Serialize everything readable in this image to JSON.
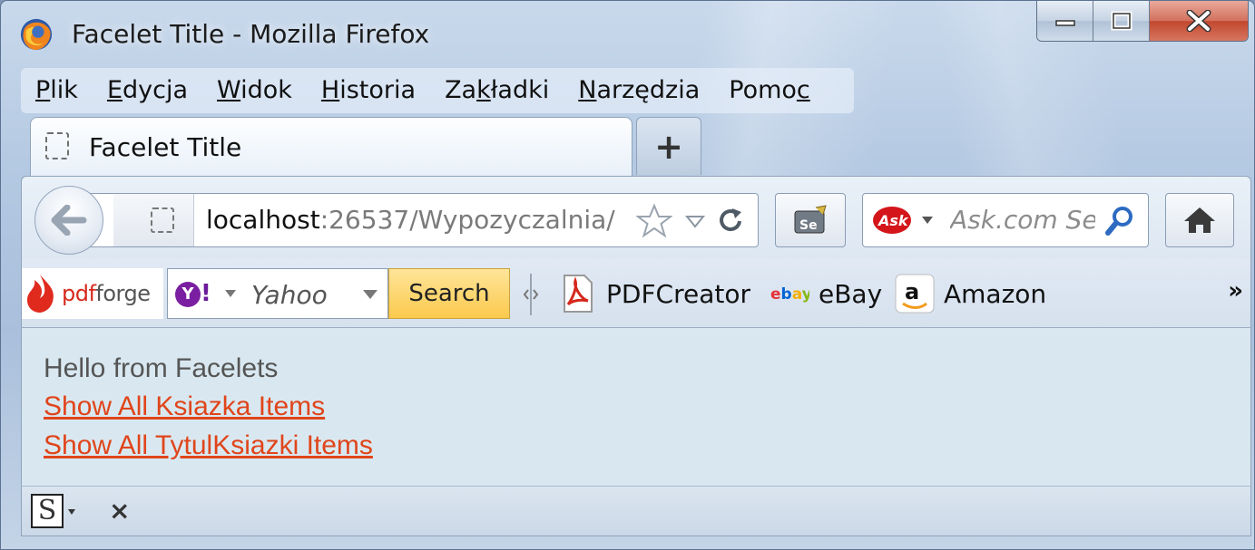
{
  "window": {
    "title": "Facelet Title - Mozilla Firefox"
  },
  "menu": {
    "items": [
      {
        "label": "Plik",
        "accel": "P",
        "rest": "lik"
      },
      {
        "label": "Edycja",
        "accel": "E",
        "rest": "dycja"
      },
      {
        "label": "Widok",
        "accel": "W",
        "rest": "idok"
      },
      {
        "label": "Historia",
        "accel": "H",
        "rest": "istoria"
      },
      {
        "label": "Zakładki",
        "pre": "Za",
        "accel": "k",
        "rest": "ładki"
      },
      {
        "label": "Narzędzia",
        "accel": "N",
        "rest": "arzędzia"
      },
      {
        "label": "Pomoc",
        "pre": "Pomo",
        "accel": "c",
        "rest": ""
      }
    ]
  },
  "tabs": [
    {
      "label": "Facelet Title",
      "active": true
    }
  ],
  "new_tab_label": "+",
  "nav": {
    "url_host": "localhost",
    "url_rest": ":26537/Wypozyczalnia/",
    "search_placeholder": "Ask.com Se",
    "search_engine_logo": "Ask"
  },
  "toolbar2": {
    "pdfforge_a": "pdf",
    "pdfforge_b": "forge",
    "yahoo_logo": "Y!",
    "yahoo_text": "Yahoo",
    "search_label": "Search",
    "bookmarks": [
      {
        "label": "PDFCreator",
        "icon": "pdf-icon"
      },
      {
        "label": "eBay",
        "icon": "ebay-icon"
      },
      {
        "label": "Amazon",
        "icon": "amazon-icon"
      }
    ],
    "overflow": "»"
  },
  "page": {
    "greeting": "Hello from Facelets",
    "links": [
      "Show All Ksiazka Items",
      "Show All TytulKsiazki Items"
    ]
  },
  "addon_bar": {
    "s_icon": "S",
    "close": "×"
  },
  "colors": {
    "link": "#e0451b",
    "close_button": "#c2472f",
    "search_button": "#fbc94d"
  }
}
